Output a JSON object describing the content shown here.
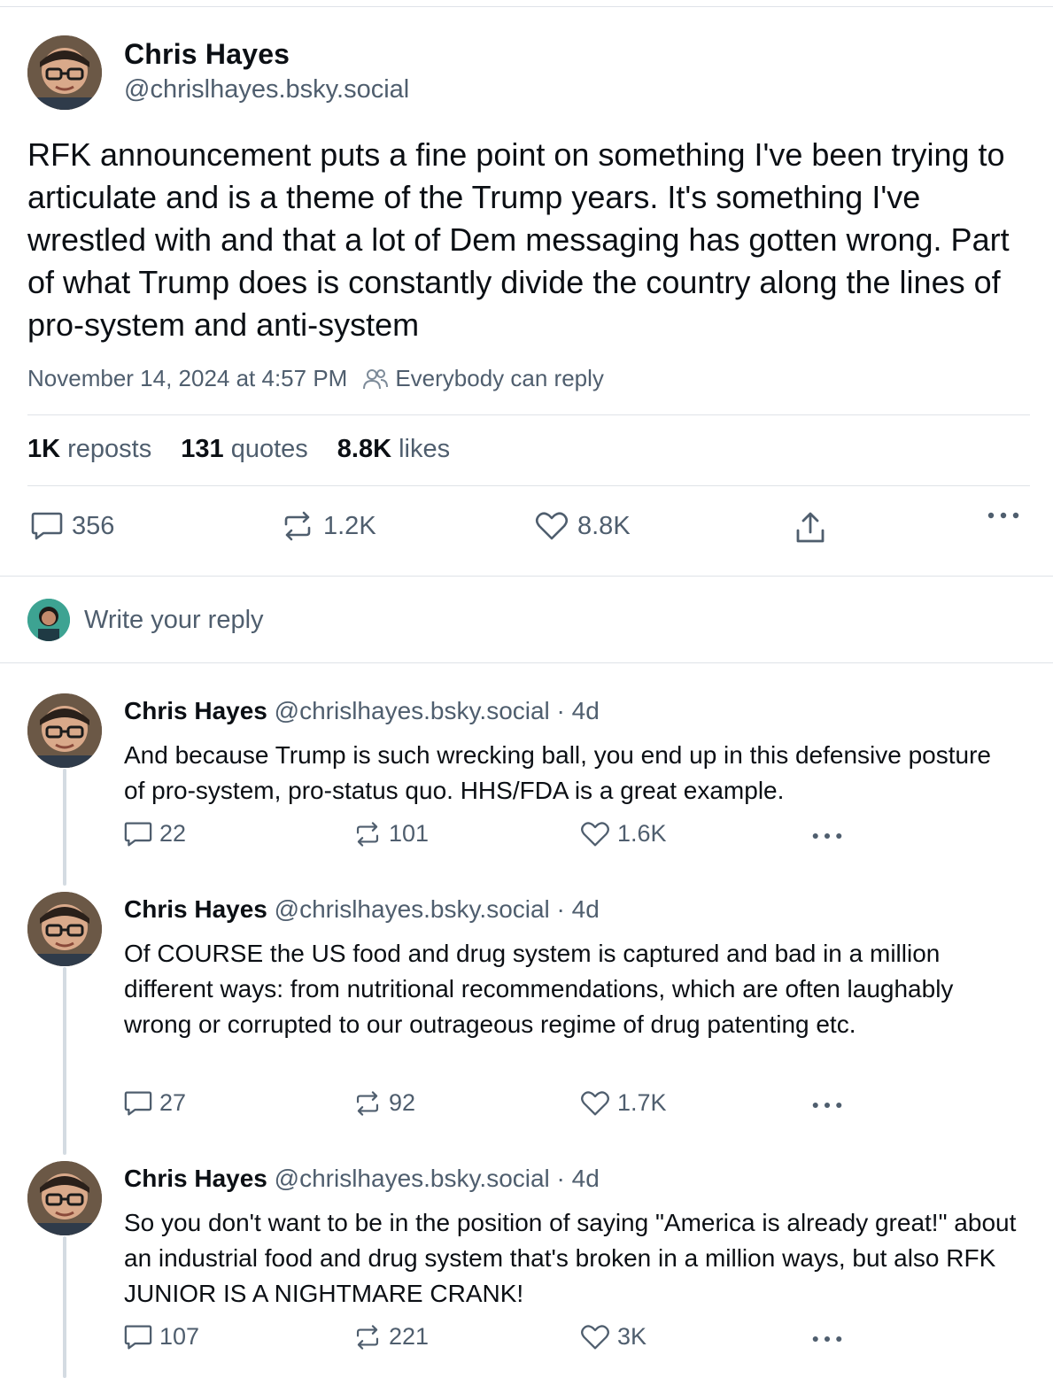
{
  "post": {
    "author_name": "Chris Hayes",
    "author_handle": "@chrislhayes.bsky.social",
    "text": "RFK announcement puts a fine point on something I've been trying to articulate and is a theme of the Trump years. It's something I've wrestled with and that a lot of Dem messaging has gotten wrong. Part of what Trump does is constantly divide the country along the lines of pro-system and anti-system",
    "timestamp": "November 14, 2024 at 4:57 PM",
    "reply_setting": "Everybody can reply",
    "stats": {
      "reposts_count": "1K",
      "reposts_label": "reposts",
      "quotes_count": "131",
      "quotes_label": "quotes",
      "likes_count": "8.8K",
      "likes_label": "likes"
    },
    "actions": {
      "replies": "356",
      "reposts": "1.2K",
      "likes": "8.8K"
    }
  },
  "reply_box": {
    "placeholder": "Write your reply"
  },
  "replies": [
    {
      "author_name": "Chris Hayes",
      "handle_time": "@chrislhayes.bsky.social · 4d",
      "text": "And because Trump is such wrecking ball, you end up in this defensive posture of pro-system, pro-status quo. HHS/FDA is a great example.",
      "replies": "22",
      "reposts": "101",
      "likes": "1.6K"
    },
    {
      "author_name": "Chris Hayes",
      "handle_time": "@chrislhayes.bsky.social · 4d",
      "text": "Of COURSE the US food and drug system is captured and bad in a million different ways: from nutritional recommendations, which are often laughably wrong or corrupted to our outrageous regime of drug patenting etc.",
      "replies": "27",
      "reposts": "92",
      "likes": "1.7K"
    },
    {
      "author_name": "Chris Hayes",
      "handle_time": "@chrislhayes.bsky.social · 4d",
      "text": "So you don't want to be in the position of saying \"America is already great!\" about an industrial food and drug system that's broken in a million ways, but also RFK JUNIOR IS A NIGHTMARE CRANK!",
      "replies": "107",
      "reposts": "221",
      "likes": "3K"
    }
  ],
  "icons": {
    "reply": "speech-bubble-icon",
    "repost": "repost-arrows-icon",
    "like": "heart-icon",
    "share": "share-upload-icon",
    "more": "ellipsis-icon",
    "audience": "people-icon"
  },
  "colors": {
    "text_primary": "#0b0f14",
    "text_secondary": "#4f5e6e",
    "divider": "#dfe3e8",
    "thread_line": "#d4dbe2"
  }
}
